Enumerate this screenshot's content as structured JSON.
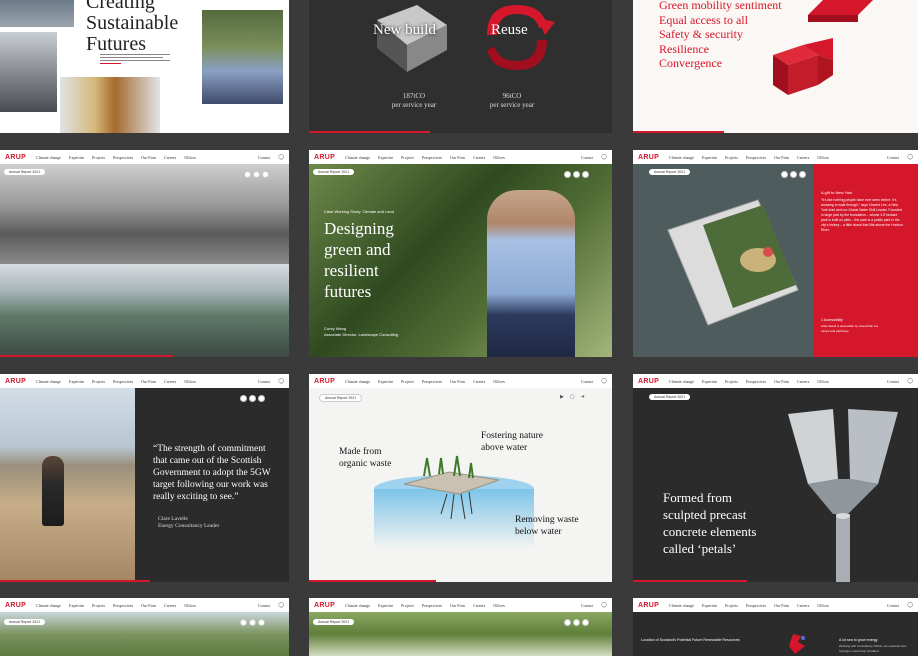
{
  "nav": {
    "logo": "ARUP",
    "links": [
      "Climate change",
      "Expertise",
      "Projects",
      "Perspectives",
      "Our Firm",
      "Careers",
      "Offices"
    ],
    "contact": "Contact"
  },
  "badge": "Annual Report 2021",
  "tile_creating": {
    "title_lines": [
      "Creating",
      "Sustainable",
      "Futures"
    ]
  },
  "tile_build": {
    "new_build": "New build",
    "reuse": "Reuse",
    "new_build_value": "187tCO",
    "new_build_unit": "per service year",
    "reuse_value": "96tCO",
    "reuse_unit": "per service year"
  },
  "tile_mobility": {
    "lines": [
      "Green mobility sentiment",
      "Equal access to all",
      "Safety & security",
      "Resilience",
      "Convergence"
    ]
  },
  "tile_designing": {
    "kicker": "Case Working Study: Climate and Land",
    "headline_lines": [
      "Designing",
      "green and",
      "resilient",
      "futures"
    ],
    "person": "Corey Wang",
    "role": "Associate Director, Landscape Consulting"
  },
  "tile_newyork": {
    "heading": "A gift to New York",
    "body": "\"It's like nothing people have ever seen before. It's amazing to walk through,\" says Vincent Lee, a New York lead and our Global Water Skill Leader. Founded in large part by the foundation – whose 4.5 hectare park is built on piles – the park is a public park in the city's history – a little island that lifts above the Hudson River.",
    "footer_heading": "1 Accessibility",
    "footer_body": "Little Island is accessible by wheelchair via ramps and pathways."
  },
  "tile_quote": {
    "quote": "“The strength of commitment that came out of the Scottish Government to adopt the 5GW target following our work was really exciting to see.”",
    "name": "Clare Lavelle",
    "role": "Energy Consultancy Leader"
  },
  "tile_organic": {
    "made_from": "Made from organic waste",
    "fostering": "Fostering nature above water",
    "removing": "Removing waste below water"
  },
  "tile_petals": {
    "lines": [
      "Formed from",
      "sculpted precast",
      "concrete elements",
      "called ‘petals’"
    ]
  },
  "tile_scotland": {
    "left_heading": "Location of Scotland's Potential Future Renewable Resources",
    "right_heading": "A lot sea to grow energy",
    "right_body": "Working with consultancy Ofinck, we explored how hydrogen could help Scotland"
  },
  "colors": {
    "accent": "#d4172a",
    "dark": "#2b2b2b",
    "bg": "#3a3a3a"
  }
}
